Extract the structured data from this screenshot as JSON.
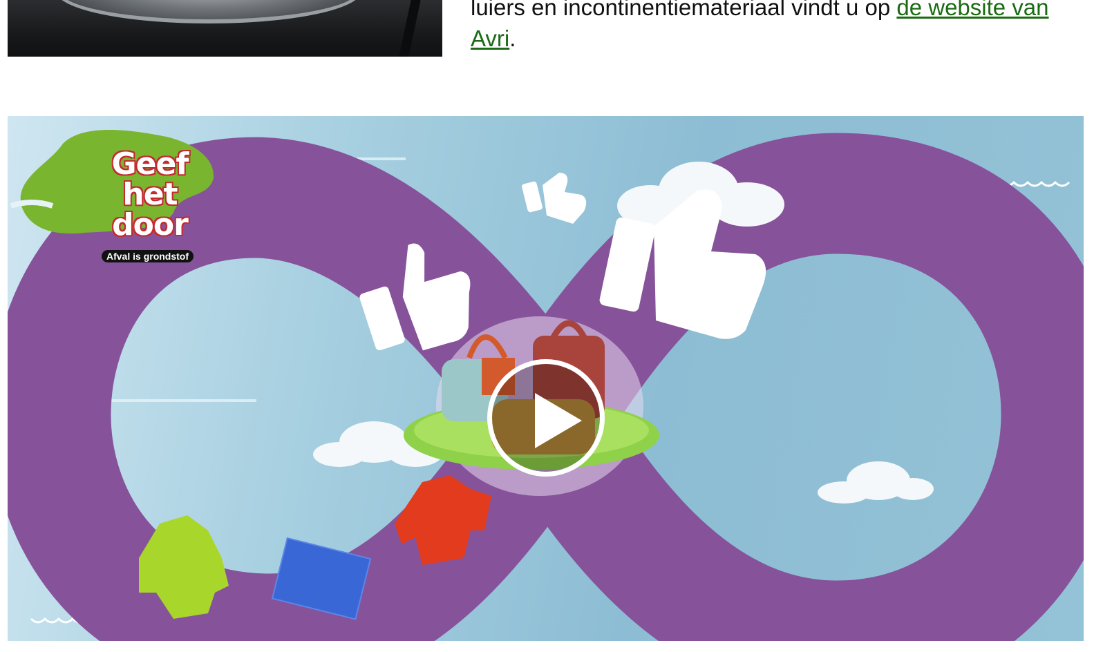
{
  "paragraph": {
    "text_before": "luiers en incontinentiemateriaal vindt u op ",
    "link_text": "de website van Avri",
    "text_after": "."
  },
  "photo": {
    "alt": "photo"
  },
  "video": {
    "logo": {
      "line1": "Geef",
      "line2": "het",
      "line3": "door",
      "tagline": "Afval is grondstof"
    },
    "play_icon": "play-icon",
    "colors": {
      "infinity": "#86539a",
      "sky": "#94c2d6",
      "logo_red": "#c42a2f",
      "logo_green": "#7ab52f",
      "link": "#1a6b13"
    }
  }
}
